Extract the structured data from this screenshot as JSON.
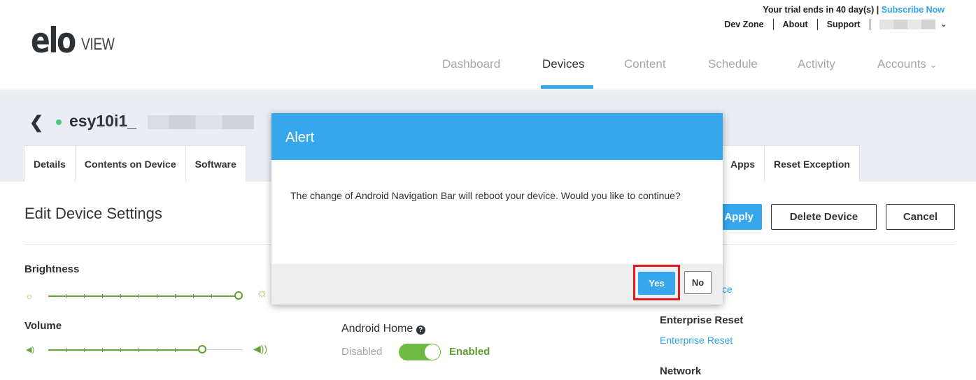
{
  "header": {
    "logo_main": "elo",
    "logo_sub": "VIEW",
    "trial_text": "Your trial ends in 40 day(s) |",
    "subscribe_label": "Subscribe Now",
    "links": [
      "Dev Zone",
      "About",
      "Support"
    ]
  },
  "nav": {
    "items": [
      "Dashboard",
      "Devices",
      "Content",
      "Schedule",
      "Activity",
      "Accounts"
    ],
    "active": "Devices",
    "accounts_chevron": "⌄"
  },
  "device": {
    "back_icon": "❮",
    "name_prefix": "esy10i1_",
    "status_color": "#4cc878"
  },
  "tabs": {
    "left": [
      "Details",
      "Contents on Device",
      "Software"
    ],
    "right": [
      "Apps",
      "Reset Exception"
    ]
  },
  "page": {
    "title": "Edit Device Settings",
    "apply_label": "Apply",
    "delete_label": "Delete Device",
    "cancel_label": "Cancel"
  },
  "settings": {
    "brightness_label": "Brightness",
    "brightness_level": 1.0,
    "volume_label": "Volume",
    "volume_level": 0.75,
    "android_home_label": "Android Home",
    "help_icon": "❓",
    "toggle_off_label": "Disabled",
    "toggle_on_label": "Enabled",
    "toggle_value": true,
    "side_link_partial": "ce",
    "enterprise_reset_heading": "Enterprise Reset",
    "enterprise_reset_link": "Enterprise Reset",
    "network_heading": "Network"
  },
  "modal": {
    "title": "Alert",
    "message": "The change of Android Navigation Bar will reboot your device. Would you like to continue?",
    "yes_label": "Yes",
    "no_label": "No"
  },
  "colors": {
    "accent": "#36a7ec",
    "slider": "#66a33b",
    "highlight": "#e01b22"
  }
}
